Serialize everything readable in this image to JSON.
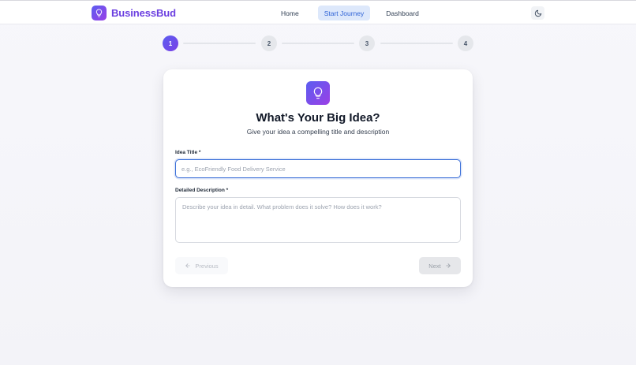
{
  "header": {
    "brand_name": "BusinessBud",
    "nav": [
      {
        "label": "Home"
      },
      {
        "label": "Start Journey",
        "active": true
      },
      {
        "label": "Dashboard"
      }
    ],
    "theme_icon": "moon-icon",
    "logo_icon": "lightbulb-icon"
  },
  "stepper": {
    "steps": [
      "1",
      "2",
      "3",
      "4"
    ],
    "current": 1
  },
  "card": {
    "icon": "lightbulb-icon",
    "title": "What's Your Big Idea?",
    "subtitle": "Give your idea a compelling title and description",
    "idea_title": {
      "label": "Idea Title *",
      "value": "",
      "placeholder": "e.g., EcoFriendly Food Delivery Service"
    },
    "description": {
      "label": "Detailed Description *",
      "value": "",
      "placeholder": "Describe your idea in detail. What problem does it solve? How does it work?"
    },
    "previous_label": "Previous",
    "next_label": "Next"
  },
  "colors": {
    "brand": "#6b3fe0",
    "accent_gradient_start": "#5b5ef0",
    "accent_gradient_end": "#9b3fe6",
    "focus_border": "#3b6fd8",
    "nav_active_bg": "#dde8fb"
  }
}
